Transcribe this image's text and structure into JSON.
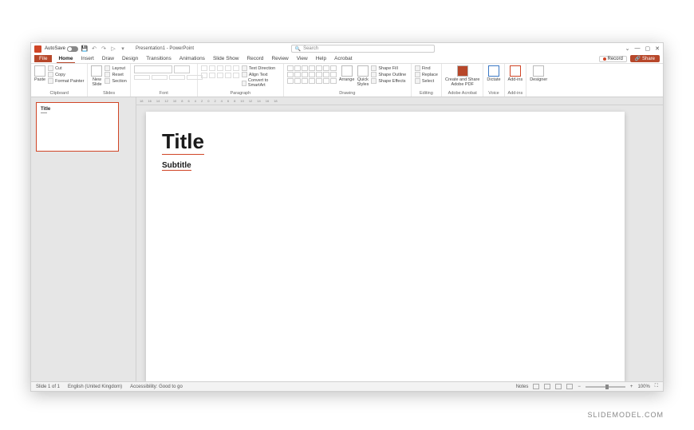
{
  "titlebar": {
    "autosave_label": "AutoSave",
    "doc_title": "Presentation1 - PowerPoint",
    "search_placeholder": "Search"
  },
  "tabs": [
    "File",
    "Home",
    "Insert",
    "Draw",
    "Design",
    "Transitions",
    "Animations",
    "Slide Show",
    "Record",
    "Review",
    "View",
    "Help",
    "Acrobat"
  ],
  "tabstrip_right": {
    "record": "Record",
    "share": "Share"
  },
  "ribbon": {
    "clipboard": {
      "paste": "Paste",
      "cut": "Cut",
      "copy": "Copy",
      "format_painter": "Format Painter",
      "label": "Clipboard"
    },
    "slides": {
      "new_slide": "New\nSlide",
      "layout": "Layout",
      "reset": "Reset",
      "section": "Section",
      "label": "Slides"
    },
    "font": {
      "label": "Font"
    },
    "paragraph": {
      "text_direction": "Text Direction",
      "align_text": "Align Text",
      "convert": "Convert to SmartArt",
      "label": "Paragraph"
    },
    "drawing": {
      "arrange": "Arrange",
      "quick_styles": "Quick\nStyles",
      "shape_fill": "Shape Fill",
      "shape_outline": "Shape Outline",
      "shape_effects": "Shape Effects",
      "label": "Drawing"
    },
    "editing": {
      "find": "Find",
      "replace": "Replace",
      "select": "Select",
      "label": "Editing"
    },
    "acrobat": {
      "btn": "Create and Share\nAdobe PDF",
      "label": "Adobe Acrobat"
    },
    "voice": {
      "dictate": "Dictate",
      "label": "Voice"
    },
    "addins": {
      "addins": "Add-ins",
      "label": "Add-ins"
    },
    "designer": {
      "designer": "Designer"
    }
  },
  "thumb": {
    "title": "Title"
  },
  "slide": {
    "title": "Title",
    "subtitle": "Subtitle"
  },
  "statusbar": {
    "slide": "Slide 1 of 1",
    "lang": "English (United Kingdom)",
    "accessibility": "Accessibility: Good to go",
    "notes": "Notes",
    "zoom": "100%"
  },
  "watermark": "SLIDEMODEL.COM"
}
